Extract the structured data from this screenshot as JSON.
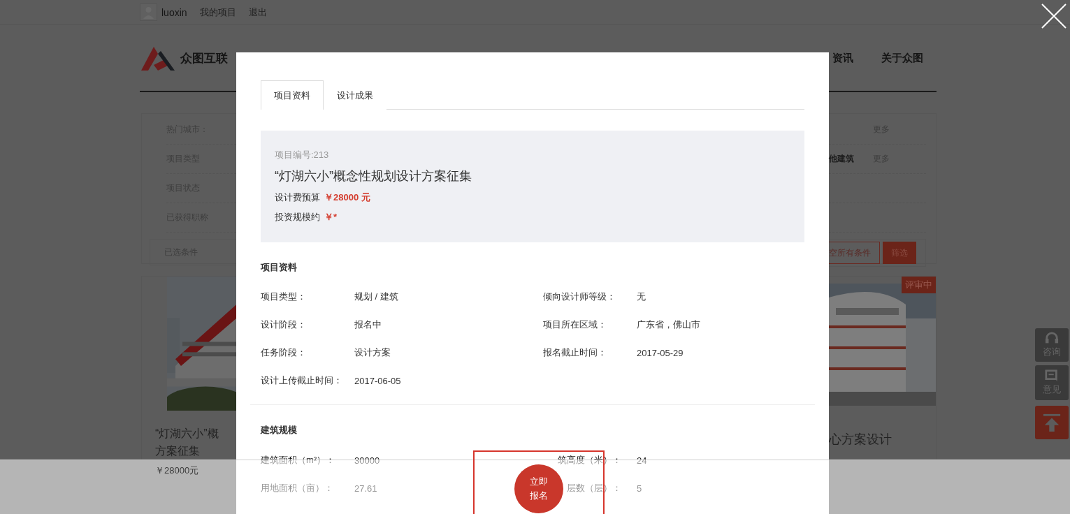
{
  "top_bar": {
    "username": "luoxin",
    "links": [
      "我的项目",
      "退出"
    ]
  },
  "header": {
    "logo_text": "众图互联",
    "nav": [
      "资讯",
      "关于众图"
    ]
  },
  "filters": {
    "rows": [
      {
        "label": "热门城市：",
        "more": "更多"
      },
      {
        "label": "项目类型",
        "option": "他建筑",
        "more": "更多"
      },
      {
        "label": "项目状态"
      },
      {
        "label": "已获得职称"
      }
    ],
    "selected_label": "已选条件",
    "clear_button": "空所有条件",
    "filter_button": "筛选"
  },
  "left_card": {
    "title_lines": [
      "“灯湖六小”概",
      "方案征集"
    ],
    "price": "￥28000元"
  },
  "right_card": {
    "badge": "评审中",
    "title": "心方案设计"
  },
  "side_tools": [
    {
      "kind": "consult",
      "label": "咨询"
    },
    {
      "kind": "feedback",
      "label": "意见"
    },
    {
      "kind": "top"
    }
  ],
  "modal": {
    "tabs": [
      {
        "label": "项目资料",
        "selected": true
      },
      {
        "label": "设计成果",
        "selected": false
      }
    ],
    "summary": {
      "number": "项目编号:213",
      "title": "“灯湖六小”概念性规划设计方案征集",
      "budget_label": "设计费预算",
      "budget_value": "￥28000 元",
      "invest_label": "投资规模约",
      "invest_value": "￥*"
    },
    "info_title": "项目资料",
    "info": [
      {
        "label": "项目类型：",
        "value": "规划 / 建筑"
      },
      {
        "label": "倾向设计师等级：",
        "value": "无"
      },
      {
        "label": "设计阶段：",
        "value": "报名中"
      },
      {
        "label": "项目所在区域：",
        "value": "广东省，佛山市"
      },
      {
        "label": "任务阶段：",
        "value": "设计方案"
      },
      {
        "label": "报名截止时间：",
        "value": "2017-05-29"
      },
      {
        "label": "设计上传截止时间：",
        "value": "2017-06-05"
      }
    ],
    "scale_title": "建筑规模",
    "scale": [
      {
        "label": "建筑面积（m²）：",
        "value": "30000"
      },
      {
        "label": "筑高度（米）：",
        "value": "24"
      },
      {
        "label": "用地面积（亩）：",
        "value": "27.61"
      },
      {
        "label": "层数（层）：",
        "value": "5"
      }
    ]
  },
  "signup_button": "立即报名"
}
